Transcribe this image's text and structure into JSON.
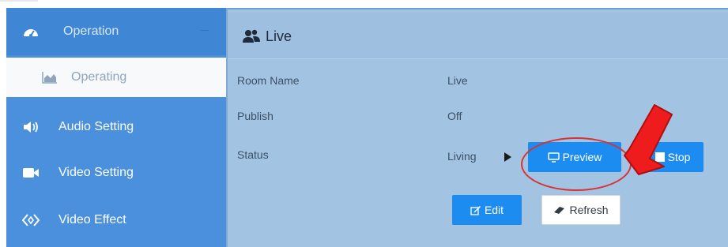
{
  "sidebar": {
    "header": {
      "label": "Operation",
      "icon": "dashboard-icon"
    },
    "items": [
      {
        "label": "Operating",
        "icon": "area-chart-icon",
        "active": true
      },
      {
        "label": "Audio Setting",
        "icon": "volume-icon"
      },
      {
        "label": "Video Setting",
        "icon": "video-camera-icon"
      },
      {
        "label": "Video Effect",
        "icon": "effect-icon"
      }
    ]
  },
  "panel": {
    "title": "Live",
    "title_icon": "users-icon",
    "rows": [
      {
        "label": "Room Name",
        "value": "Live"
      },
      {
        "label": "Publish",
        "value": "Off"
      },
      {
        "label": "Status",
        "value": "Living"
      }
    ],
    "buttons": {
      "preview": "Preview",
      "stop": "Stop",
      "edit": "Edit",
      "refresh": "Refresh"
    }
  },
  "colors": {
    "sidebar_bg": "#4a90dc",
    "panel_bg": "#a3c3e3",
    "primary_button": "#1c8cf0",
    "annotation": "#d93232"
  }
}
